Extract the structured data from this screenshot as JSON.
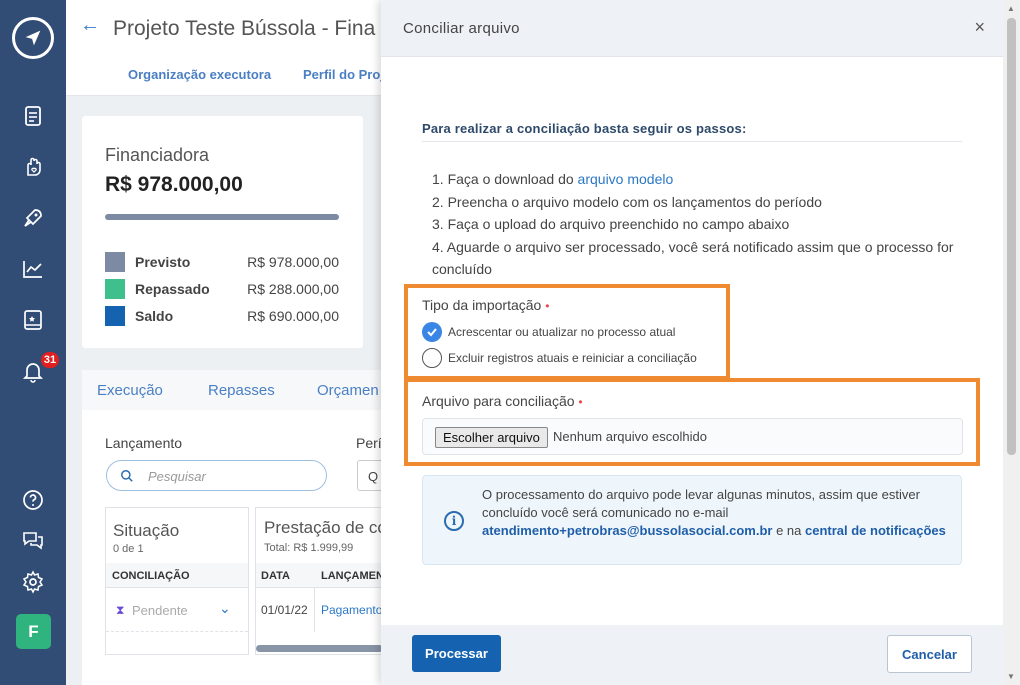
{
  "sidebar": {
    "notification_count": "31",
    "avatar_letter": "F"
  },
  "header": {
    "title": "Projeto Teste Bússola - Fina",
    "tabs": [
      "Organização executora",
      "Perfil do Proj"
    ]
  },
  "finance": {
    "label": "Financiadora",
    "value": "R$ 978.000,00",
    "legend": [
      {
        "name": "Previsto",
        "value": "R$ 978.000,00",
        "color": "#7c8aa3"
      },
      {
        "name": "Repassado",
        "value": "R$ 288.000,00",
        "color": "#3fbf8b"
      },
      {
        "name": "Saldo",
        "value": "R$ 690.000,00",
        "color": "#1563b0"
      }
    ]
  },
  "content_tabs": [
    "Execução",
    "Repasses",
    "Orçamen"
  ],
  "lancamento": {
    "label": "Lançamento",
    "period_label": "Perío",
    "search_placeholder": "Pesquisar",
    "period_value": "Q"
  },
  "situacao": {
    "title": "Situação",
    "count": "0 de 1",
    "column": "CONCILIAÇÃO",
    "status": "Pendente"
  },
  "prestacao": {
    "title": "Prestação de co",
    "total": "Total: R$ 1.999,99",
    "columns": [
      "DATA",
      "LANÇAMEN"
    ],
    "row": {
      "date": "01/01/22",
      "lancamento": "Pagamento"
    }
  },
  "modal": {
    "title": "Conciliar arquivo",
    "close": "×",
    "intro": "Para realizar a conciliação basta seguir os passos:",
    "step1_prefix": "1. Faça o download do ",
    "step1_link": "arquivo modelo",
    "step2": "2. Preencha o arquivo modelo com os lançamentos do período",
    "step3": "3. Faça o upload do arquivo preenchido no campo abaixo",
    "step4": "4. Aguarde o arquivo ser processado, você será notificado assim que o processo for concluído",
    "import_type_label": "Tipo da importação",
    "required_mark": "•",
    "radio_options": [
      {
        "label": "Acrescentar ou atualizar no processo atual",
        "selected": true
      },
      {
        "label": "Excluir registros atuais e reiniciar a conciliação",
        "selected": false
      }
    ],
    "file_label": "Arquivo para conciliação",
    "file_button": "Escolher arquivo",
    "file_status": "Nenhum arquivo escolhido",
    "info_text": "O processamento do arquivo pode levar algunas minutos, assim que estiver concluído você será comunicado no e-mail ",
    "info_email": "atendimento+petrobras@bussolasocial.com.br",
    "info_mid": " e na ",
    "info_link": "central de notificações",
    "process_button": "Processar",
    "cancel_button": "Cancelar"
  },
  "colors": {
    "sidebar_bg": "#324d75",
    "primary": "#1563b0",
    "highlight": "#f08a30",
    "success": "#2fb37f"
  }
}
